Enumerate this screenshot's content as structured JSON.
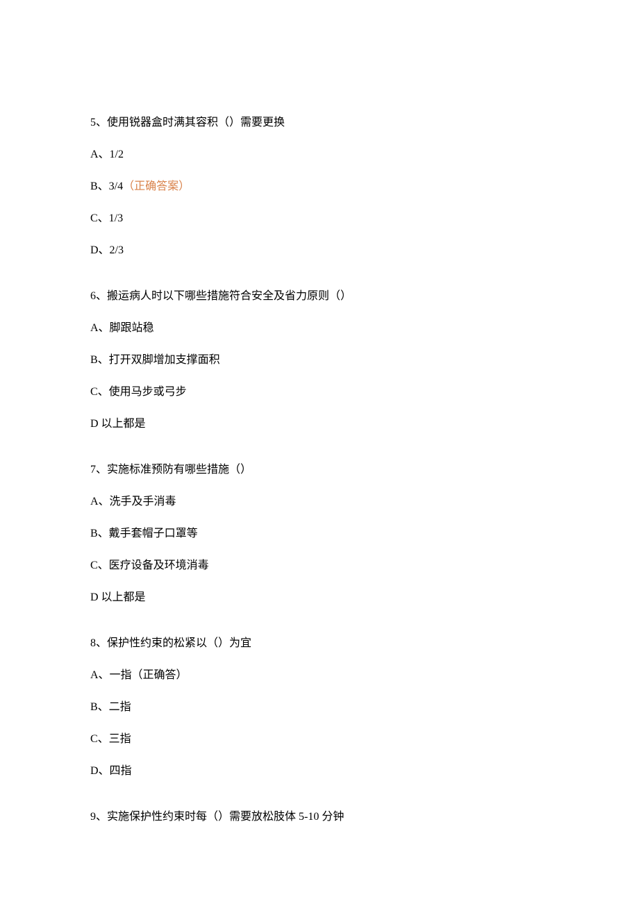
{
  "questions": {
    "q5": {
      "text": "5、使用锐器盒时满其容积（）需要更换",
      "options": {
        "a": "A、1/2",
        "b_prefix": "B、3/4",
        "b_answer": "（正确答案）",
        "c": "C、1/3",
        "d": "D、2/3"
      }
    },
    "q6": {
      "text": "6、搬运病人时以下哪些措施符合安全及省力原则（）",
      "options": {
        "a": "A、脚跟站稳",
        "b": "B、打开双脚增加支撑面积",
        "c": "C、使用马步或弓步",
        "d": "D 以上都是"
      }
    },
    "q7": {
      "text": "7、实施标准预防有哪些措施（）",
      "options": {
        "a": "A、洗手及手消毒",
        "b": "B、戴手套帽子口罩等",
        "c": "C、医疗设备及环境消毒",
        "d": "D 以上都是"
      }
    },
    "q8": {
      "text": "8、保护性约束的松紧以（）为宜",
      "options": {
        "a": "A、一指（正确答）",
        "b": "B、二指",
        "c": "C、三指",
        "d": "D、四指"
      }
    },
    "q9": {
      "text": "9、实施保护性约束时每（）需要放松肢体 5-10 分钟"
    }
  }
}
